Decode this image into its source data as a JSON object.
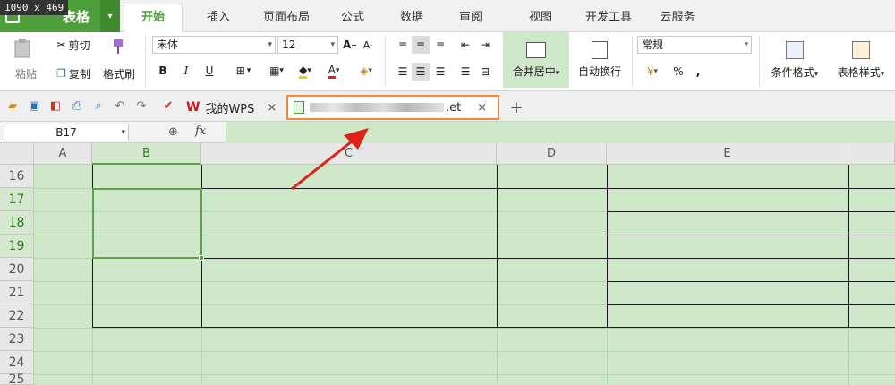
{
  "size_badge": "1090 x 469",
  "app": {
    "name": "表格"
  },
  "menu_tabs": [
    {
      "label": "开始"
    },
    {
      "label": "插入"
    },
    {
      "label": "页面布局"
    },
    {
      "label": "公式"
    },
    {
      "label": "数据"
    },
    {
      "label": "审阅"
    },
    {
      "label": "视图"
    },
    {
      "label": "开发工具"
    },
    {
      "label": "云服务"
    }
  ],
  "ribbon": {
    "paste": "粘贴",
    "cut": "剪切",
    "copy": "复制",
    "format_painter": "格式刷",
    "font_name": "宋体",
    "font_size": "12",
    "merge_center": "合并居中",
    "wrap_text": "自动换行",
    "number_format": "常规",
    "conditional_format": "条件格式",
    "table_style": "表格样式",
    "percent": "%",
    "comma": ","
  },
  "doc_tabs": {
    "home_tab": "我的WPS",
    "active_tab_ext": ".et",
    "close_glyph": "×",
    "add_glyph": "+"
  },
  "formula_bar": {
    "cell_ref": "B17",
    "fx": "fx"
  },
  "columns": [
    {
      "label": "A"
    },
    {
      "label": "B"
    },
    {
      "label": "C"
    },
    {
      "label": "D"
    },
    {
      "label": "E"
    }
  ],
  "rows": [
    {
      "label": "16"
    },
    {
      "label": "17"
    },
    {
      "label": "18"
    },
    {
      "label": "19"
    },
    {
      "label": "20"
    },
    {
      "label": "21"
    },
    {
      "label": "22"
    },
    {
      "label": "23"
    },
    {
      "label": "24"
    },
    {
      "label": "25"
    }
  ],
  "colors": {
    "accent": "#4e9e3b",
    "annotation": "#f08a3a",
    "arrow": "#e0201b",
    "sheet_bg": "#cfe8c9"
  }
}
